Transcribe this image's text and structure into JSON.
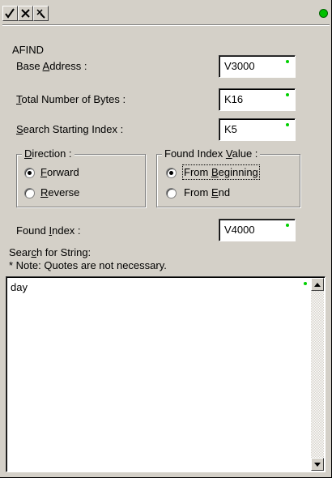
{
  "toolbar": {
    "ok_icon": "check-icon",
    "cancel_icon": "cancel-icon",
    "help_icon": "help-icon",
    "status_color": "#00c000"
  },
  "section_title": "AFIND",
  "fields": {
    "base_address": {
      "label_pre": "Base ",
      "label_key": "A",
      "label_post": "ddress :",
      "value": "V3000"
    },
    "total_bytes": {
      "label_pre": "",
      "label_key": "T",
      "label_post": "otal Number of Bytes :",
      "value": "K16"
    },
    "start_index": {
      "label_pre": "",
      "label_key": "S",
      "label_post": "earch Starting Index :",
      "value": "K5"
    },
    "found_index": {
      "label_pre": "Found ",
      "label_key": "I",
      "label_post": "ndex :",
      "value": "V4000"
    }
  },
  "direction": {
    "legend_key": "D",
    "legend_post": "irection :",
    "forward": {
      "key": "F",
      "post": "orward",
      "selected": true
    },
    "reverse": {
      "key": "R",
      "post": "everse",
      "selected": false
    }
  },
  "found_value": {
    "legend_pre": "Found Index ",
    "legend_key": "V",
    "legend_post": "alue :",
    "beginning": {
      "pre": "From ",
      "key": "B",
      "post": "eginning",
      "selected": true
    },
    "end": {
      "pre": "From ",
      "key": "E",
      "post": "nd",
      "selected": false
    }
  },
  "search_string": {
    "label_pre": "Sear",
    "label_key": "c",
    "label_post": "h for String:",
    "note": "* Note: Quotes are not necessary.",
    "value": "day"
  }
}
